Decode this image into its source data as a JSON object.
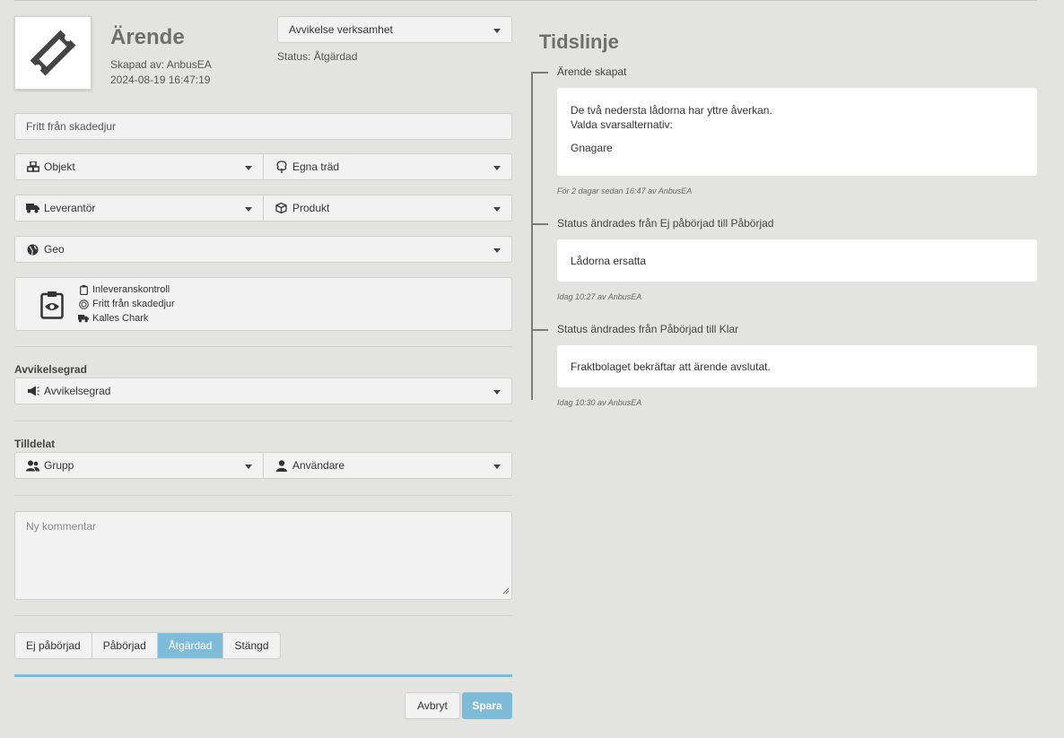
{
  "ticket": {
    "title": "Ärende",
    "created_by": "Skapad av: AnbusEA",
    "created_at": "2024-08-19 16:47:19",
    "icon": "ticket-icon"
  },
  "category_select": {
    "value": "Avvikelse verksamhet"
  },
  "status_text": "Status: Åtgärdad",
  "subject": {
    "value": "Fritt från skadedjur"
  },
  "selects": {
    "objekt": {
      "label": "Objekt",
      "icon": "cubes-icon"
    },
    "egna_trad": {
      "label": "Egna träd",
      "icon": "tree-icon"
    },
    "leverantor": {
      "label": "Leverantör",
      "icon": "truck-icon"
    },
    "produkt": {
      "label": "Produkt",
      "icon": "box-icon"
    },
    "geo": {
      "label": "Geo",
      "icon": "globe-icon"
    },
    "avvikelsegrad": {
      "label": "Avvikelsegrad",
      "icon": "megaphone-icon"
    },
    "grupp": {
      "label": "Grupp",
      "icon": "users-icon"
    },
    "anvandare": {
      "label": "Användare",
      "icon": "user-icon"
    }
  },
  "info": {
    "icon": "clipboard-eye-icon",
    "lines": [
      {
        "text": "Inleveranskontroll",
        "icon": "clipboard-icon"
      },
      {
        "text": "Fritt från skadedjur",
        "icon": "target-icon"
      },
      {
        "text": "Kalles Chark",
        "icon": "truck-icon"
      }
    ]
  },
  "sections": {
    "avvikelsegrad_label": "Avvikelsegrad",
    "tilldelat_label": "Tilldelat"
  },
  "comment": {
    "placeholder": "Ny kommentar"
  },
  "status_buttons": [
    {
      "label": "Ej påbörjad",
      "active": false
    },
    {
      "label": "Påbörjad",
      "active": false
    },
    {
      "label": "Åtgärdad",
      "active": true
    },
    {
      "label": "Stängd",
      "active": false
    }
  ],
  "actions": {
    "cancel": "Avbryt",
    "save": "Spara"
  },
  "timeline": {
    "title": "Tidslinje",
    "events": [
      {
        "heading": "Ärende skapat",
        "body_lines": [
          "De två nedersta lådorna har yttre åverkan.",
          "Valda svarsalternativ:"
        ],
        "body_extra": "Gnagare",
        "footer": "För 2 dagar sedan 16:47 av AnbusEA"
      },
      {
        "heading": "Status ändrades från Ej påbörjad till Påbörjad",
        "body_lines": [
          "Lådorna ersatta"
        ],
        "footer": "Idag 10:27 av AnbusEA"
      },
      {
        "heading": "Status ändrades från Påbörjad till Klar",
        "body_lines": [
          "Fraktbolaget bekräftar att ärende avslutat."
        ],
        "footer": "Idag 10:30 av AnbusEA"
      }
    ]
  },
  "colors": {
    "accent": "#7ebbd9",
    "background": "#e3e3e1",
    "field": "#f2f2f2"
  }
}
